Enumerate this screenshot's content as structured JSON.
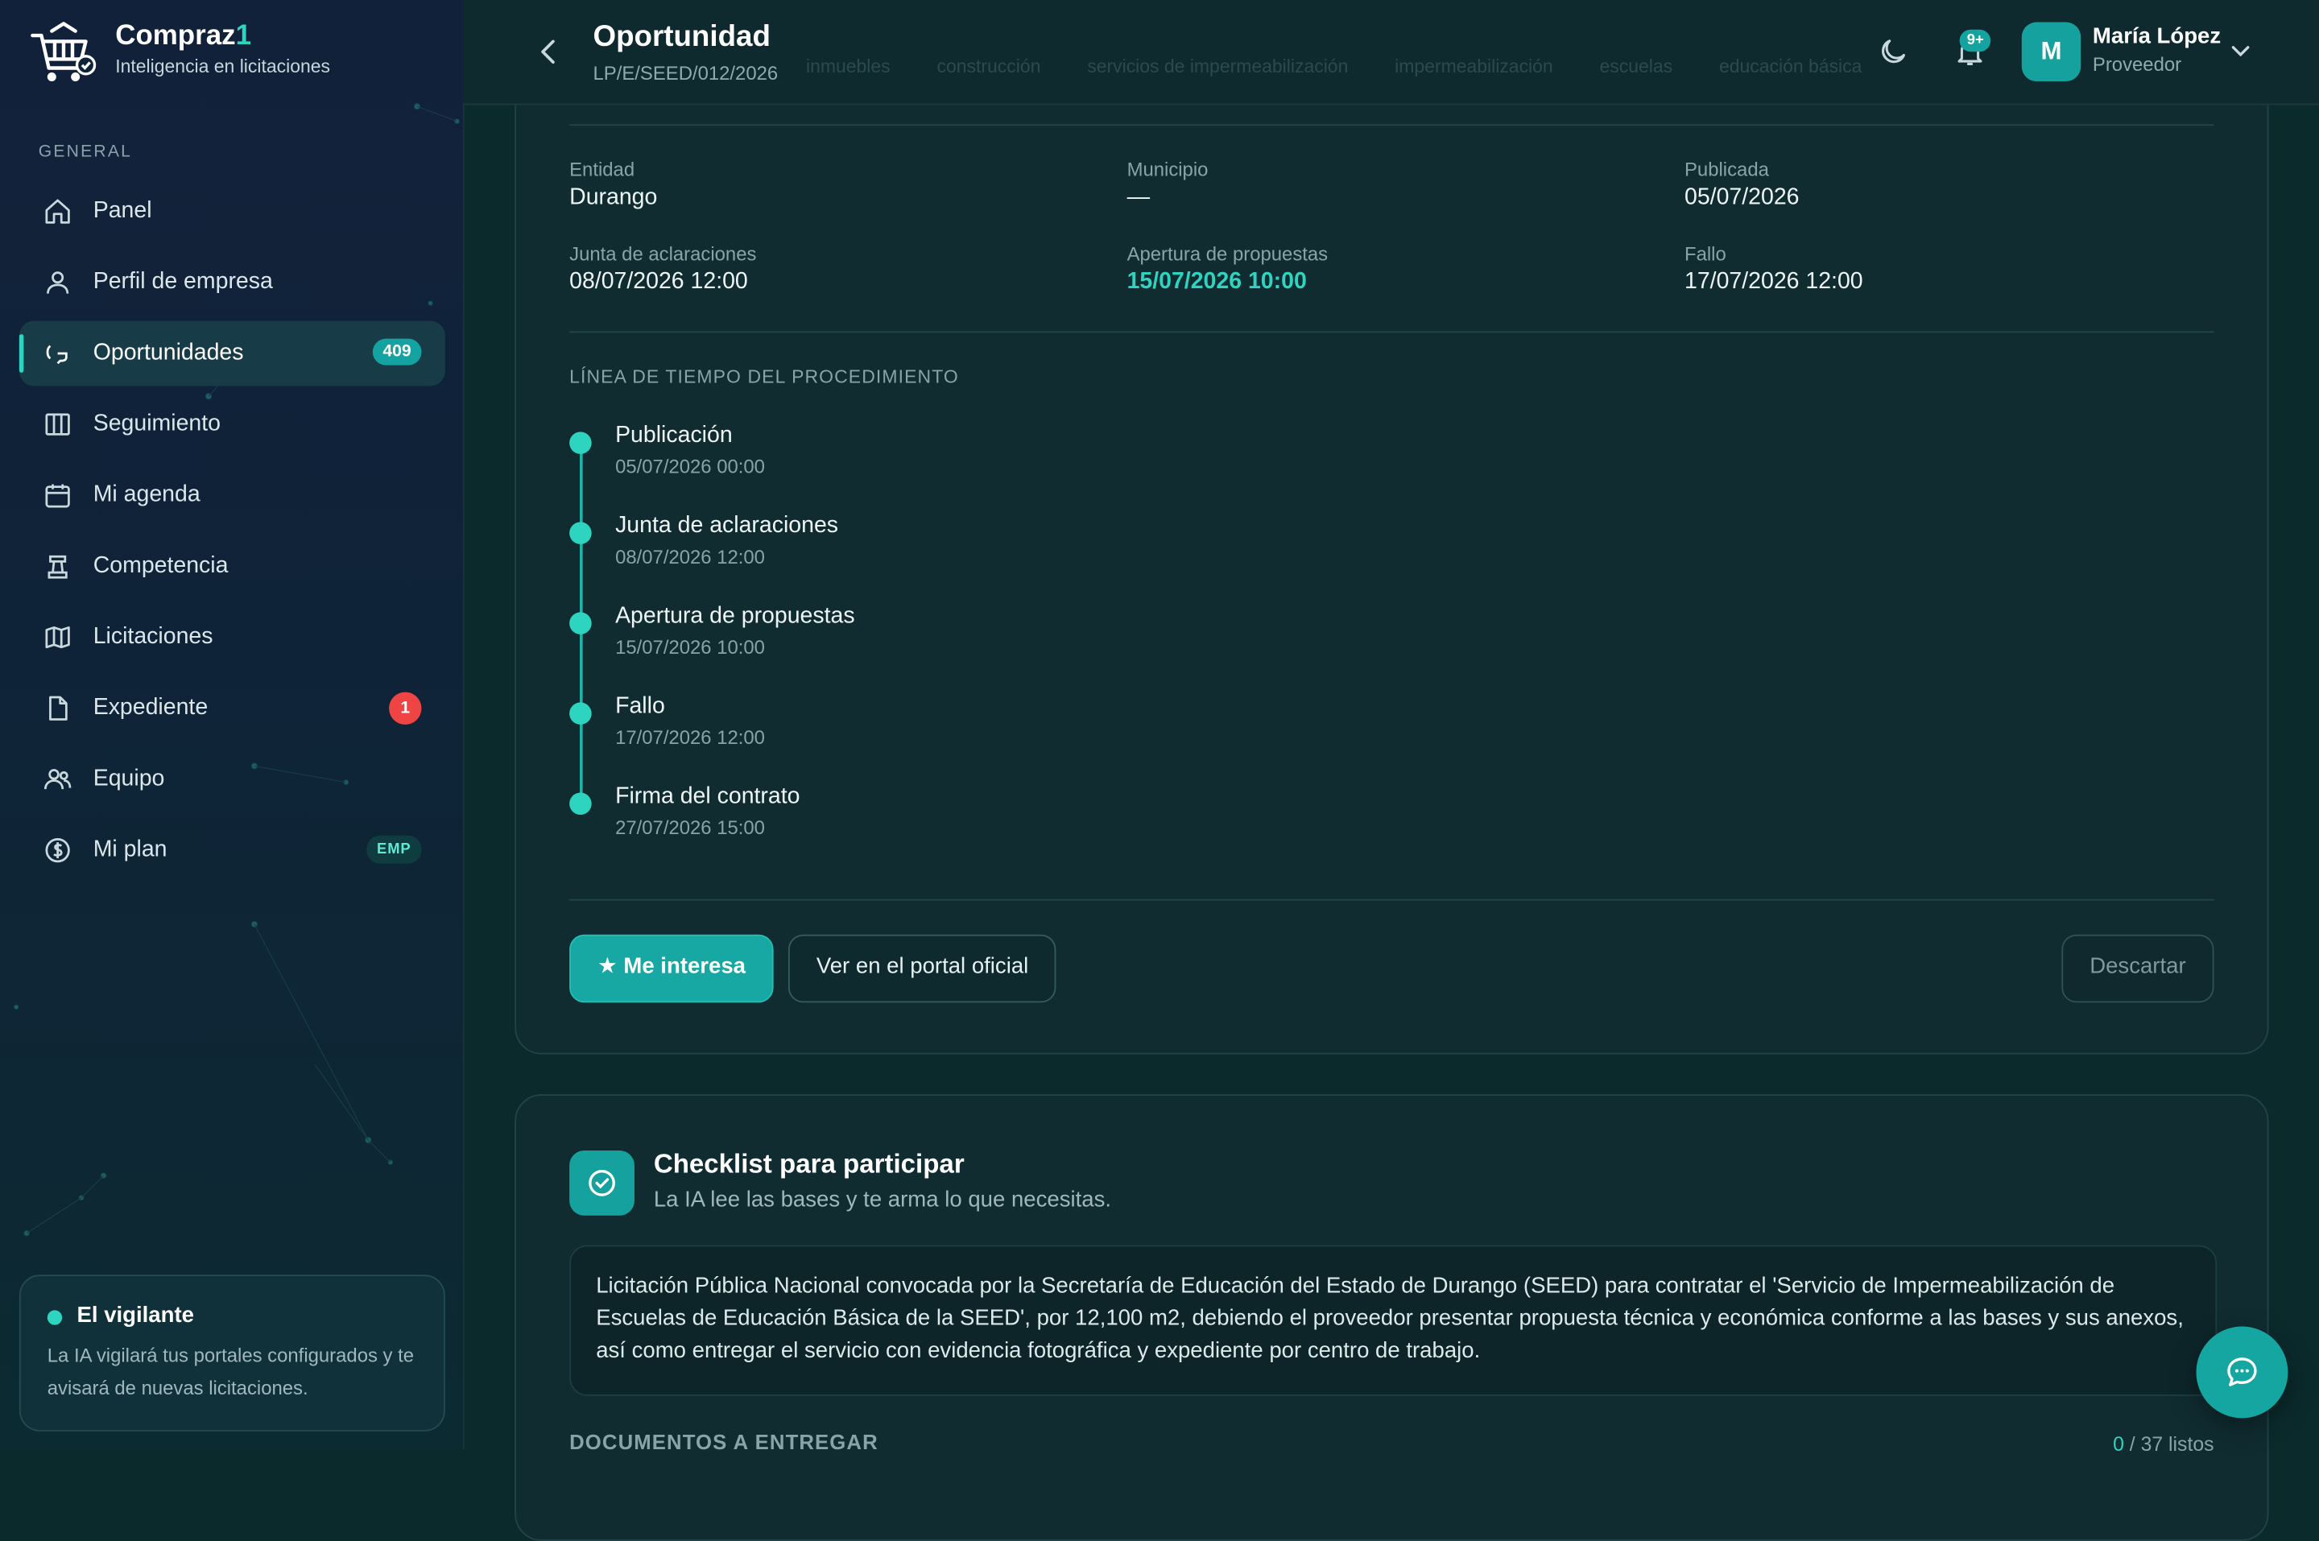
{
  "brand": {
    "name": "Compraz",
    "name_accent": "1",
    "tagline": "Inteligencia en licitaciones"
  },
  "sidebar": {
    "section": "GENERAL",
    "items": [
      {
        "label": "Panel",
        "icon": "home-icon"
      },
      {
        "label": "Perfil de empresa",
        "icon": "user-icon"
      },
      {
        "label": "Oportunidades",
        "icon": "chat-icon",
        "badge": "409",
        "active": true
      },
      {
        "label": "Seguimiento",
        "icon": "columns-icon"
      },
      {
        "label": "Mi agenda",
        "icon": "calendar-icon"
      },
      {
        "label": "Competencia",
        "icon": "chess-icon"
      },
      {
        "label": "Licitaciones",
        "icon": "map-icon"
      },
      {
        "label": "Expediente",
        "icon": "file-icon",
        "badge": "1"
      },
      {
        "label": "Equipo",
        "icon": "team-icon"
      },
      {
        "label": "Mi plan",
        "icon": "dollar-icon",
        "badge": "EMP"
      }
    ],
    "watch": {
      "title": "El vigilante",
      "description": "La IA vigilará tus portales configurados y te avisará de nuevas licitaciones."
    }
  },
  "header": {
    "title": "Oportunidad",
    "code": "LP/E/SEED/012/2026",
    "faded_tags": [
      "inmuebles",
      "construcción",
      "servicios de impermeabilización",
      "impermeabilización",
      "escuelas",
      "educación básica"
    ],
    "notifications_badge": "9+",
    "user": {
      "initial": "M",
      "name": "María López",
      "role": "Proveedor"
    }
  },
  "details": {
    "entidad": {
      "label": "Entidad",
      "value": "Durango"
    },
    "municipio": {
      "label": "Municipio",
      "value": "—"
    },
    "publicada": {
      "label": "Publicada",
      "value": "05/07/2026"
    },
    "junta": {
      "label": "Junta de aclaraciones",
      "value": "08/07/2026 12:00"
    },
    "apertura": {
      "label": "Apertura de propuestas",
      "value": "15/07/2026 10:00"
    },
    "fallo": {
      "label": "Fallo",
      "value": "17/07/2026 12:00"
    }
  },
  "timeline": {
    "heading": "LÍNEA DE TIEMPO DEL PROCEDIMIENTO",
    "steps": [
      {
        "name": "Publicación",
        "date": "05/07/2026 00:00"
      },
      {
        "name": "Junta de aclaraciones",
        "date": "08/07/2026 12:00"
      },
      {
        "name": "Apertura de propuestas",
        "date": "15/07/2026 10:00"
      },
      {
        "name": "Fallo",
        "date": "17/07/2026 12:00"
      },
      {
        "name": "Firma del contrato",
        "date": "27/07/2026 15:00"
      }
    ]
  },
  "actions": {
    "interest": "★ Me interesa",
    "portal": "Ver en el portal oficial",
    "discard": "Descartar"
  },
  "checklist": {
    "title": "Checklist para participar",
    "subtitle": "La IA lee las bases y te arma lo que necesitas.",
    "summary": "Licitación Pública Nacional convocada por la Secretaría de Educación del Estado de Durango (SEED) para contratar el 'Servicio de Impermeabilización de Escuelas de Educación Básica de la SEED', por 12,100 m2, debiendo el proveedor presentar propuesta técnica y económica conforme a las bases y sus anexos, así como entregar el servicio con evidencia fotográfica y expediente por centro de trabajo.",
    "docs_heading": "DOCUMENTOS A ENTREGAR",
    "docs_done": "0",
    "docs_total": "/ 37 listos"
  },
  "colors": {
    "accent": "#2dd4bf",
    "primary_button": "#17a8a3",
    "danger": "#ef4444"
  }
}
